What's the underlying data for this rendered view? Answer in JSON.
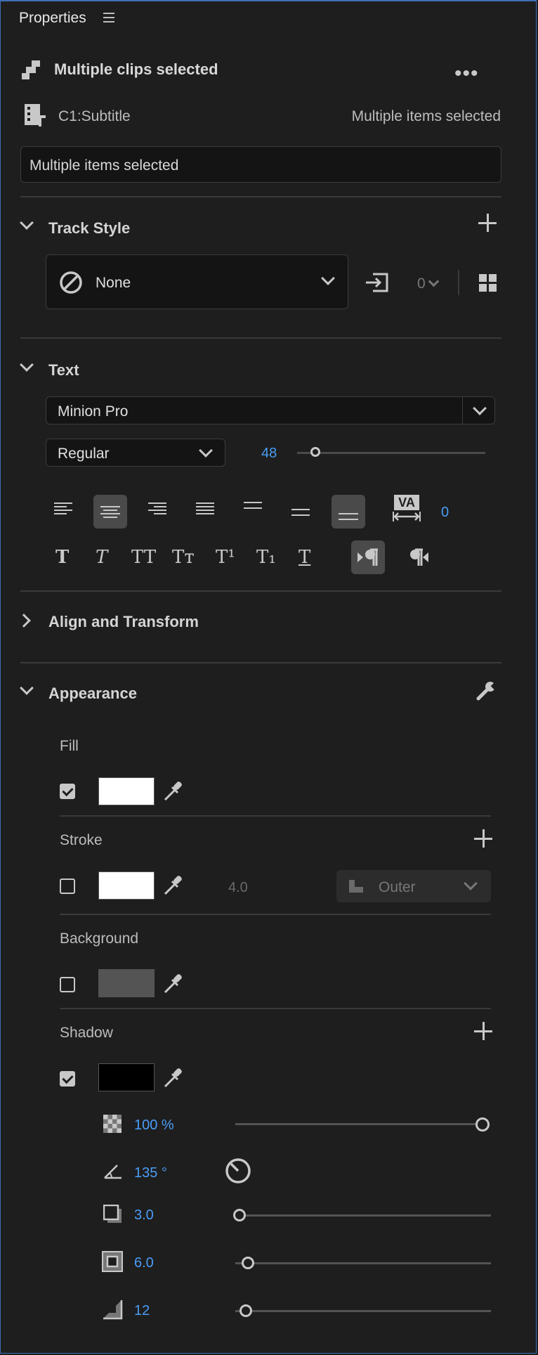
{
  "header": {
    "title": "Properties"
  },
  "clip": {
    "selection_label": "Multiple clips selected",
    "track_name": "C1:Subtitle",
    "track_value": "Multiple items selected",
    "text_field_value": "Multiple items selected"
  },
  "track_style": {
    "heading": "Track Style",
    "style_value": "None",
    "count_value": "0"
  },
  "text": {
    "heading": "Text",
    "font_family": "Minion Pro",
    "font_style": "Regular",
    "font_size": "48",
    "font_size_fraction": 0.04,
    "tracking_icon_label": "VA",
    "tracking_value": "0",
    "type_buttons": [
      "T",
      "T",
      "TT",
      "Tт",
      "T¹",
      "T₁",
      "T"
    ]
  },
  "align_transform": {
    "heading": "Align and Transform"
  },
  "appearance": {
    "heading": "Appearance",
    "fill": {
      "label": "Fill",
      "enabled": true,
      "color": "#ffffff"
    },
    "stroke": {
      "label": "Stroke",
      "enabled": false,
      "color": "#ffffff",
      "width": "4.0",
      "position": "Outer"
    },
    "background": {
      "label": "Background",
      "enabled": false,
      "color": "#555555"
    },
    "shadow": {
      "label": "Shadow",
      "enabled": true,
      "color": "#000000",
      "opacity": "100 %",
      "opacity_fraction": 1.0,
      "angle": "135 °",
      "distance": "3.0",
      "distance_fraction": 0.0,
      "size": "6.0",
      "size_fraction": 0.05,
      "blur": "12",
      "blur_fraction": 0.04
    }
  },
  "colors": {
    "accent_blue": "#4a9df5",
    "panel_bg": "#1e1e1e",
    "selection_border": "#3d6fb5"
  }
}
